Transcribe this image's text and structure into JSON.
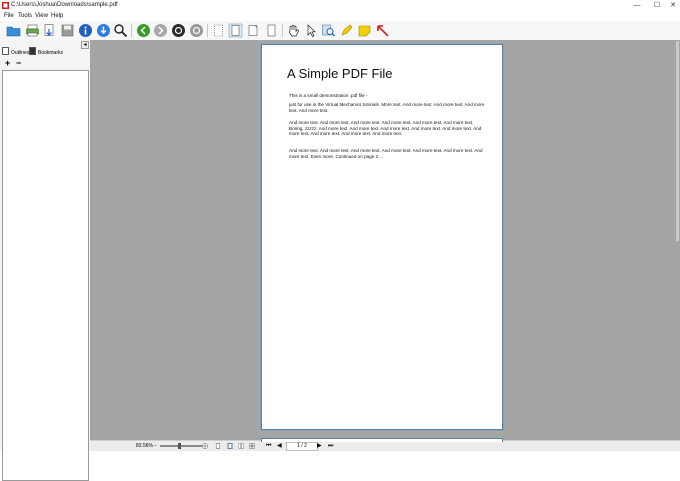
{
  "window": {
    "title": "C:\\Users\\Joshua\\Downloads\\sample.pdf",
    "minimize_glyph": "—",
    "maximize_glyph": "☐",
    "close_glyph": "✕"
  },
  "menu": {
    "items": [
      {
        "label": "File"
      },
      {
        "label": "Tools"
      },
      {
        "label": "View"
      },
      {
        "label": "Help"
      }
    ]
  },
  "toolbar": {
    "icons": [
      "open-folder-icon",
      "print-icon",
      "extract-pages-icon",
      "save-icon",
      "info-icon",
      "download-icon",
      "search-icon",
      "back-icon",
      "forward-icon",
      "rotate-left-icon",
      "rotate-right-icon",
      "crop-icon",
      "rotate-page-left-icon",
      "rotate-page-right-icon",
      "page-icon",
      "hand-tool-icon",
      "select-tool-icon",
      "zoom-tool-icon",
      "highlight-icon",
      "sticky-note-icon",
      "arrow-annotation-icon"
    ]
  },
  "left_panel": {
    "tabs": [
      {
        "label": "Outlines"
      },
      {
        "label": "Bookmarks"
      }
    ],
    "collapse_glyph": "◂",
    "add_glyph": "+",
    "remove_glyph": "−"
  },
  "document": {
    "heading": "A Simple PDF File",
    "paragraphs": [
      "This is a small demonstration .pdf file -",
      "just for use in the Virtual Mechanics tutorials. More text. And more text. And more text. And more text. And more text.",
      "And more text. And more text. And more text. And more text. And more text. And more text. Boring, zzzzz. And more text. And more text. And more text. And more text. And more text. And more text. And more text. And more text. And more text.",
      "And more text. And more text. And more text. And more text. And more text. And more text. And more text. Even more. Continued on page 2 ..."
    ]
  },
  "status": {
    "zoom": "83.56%",
    "zoom_minus": "−",
    "zoom_plus": "+",
    "page_indicator": "1 / 2",
    "first_glyph": "⏮",
    "prev_glyph": "◀",
    "next_glyph": "▶",
    "last_glyph": "⏭"
  },
  "colors": {
    "doc_background": "#a5a5a5",
    "page_border": "#5f7f9f",
    "accent_red": "#d0201c",
    "accent_yellow": "#f4d000",
    "accent_green": "#3a9a2a",
    "accent_blue": "#1f5fc0"
  }
}
